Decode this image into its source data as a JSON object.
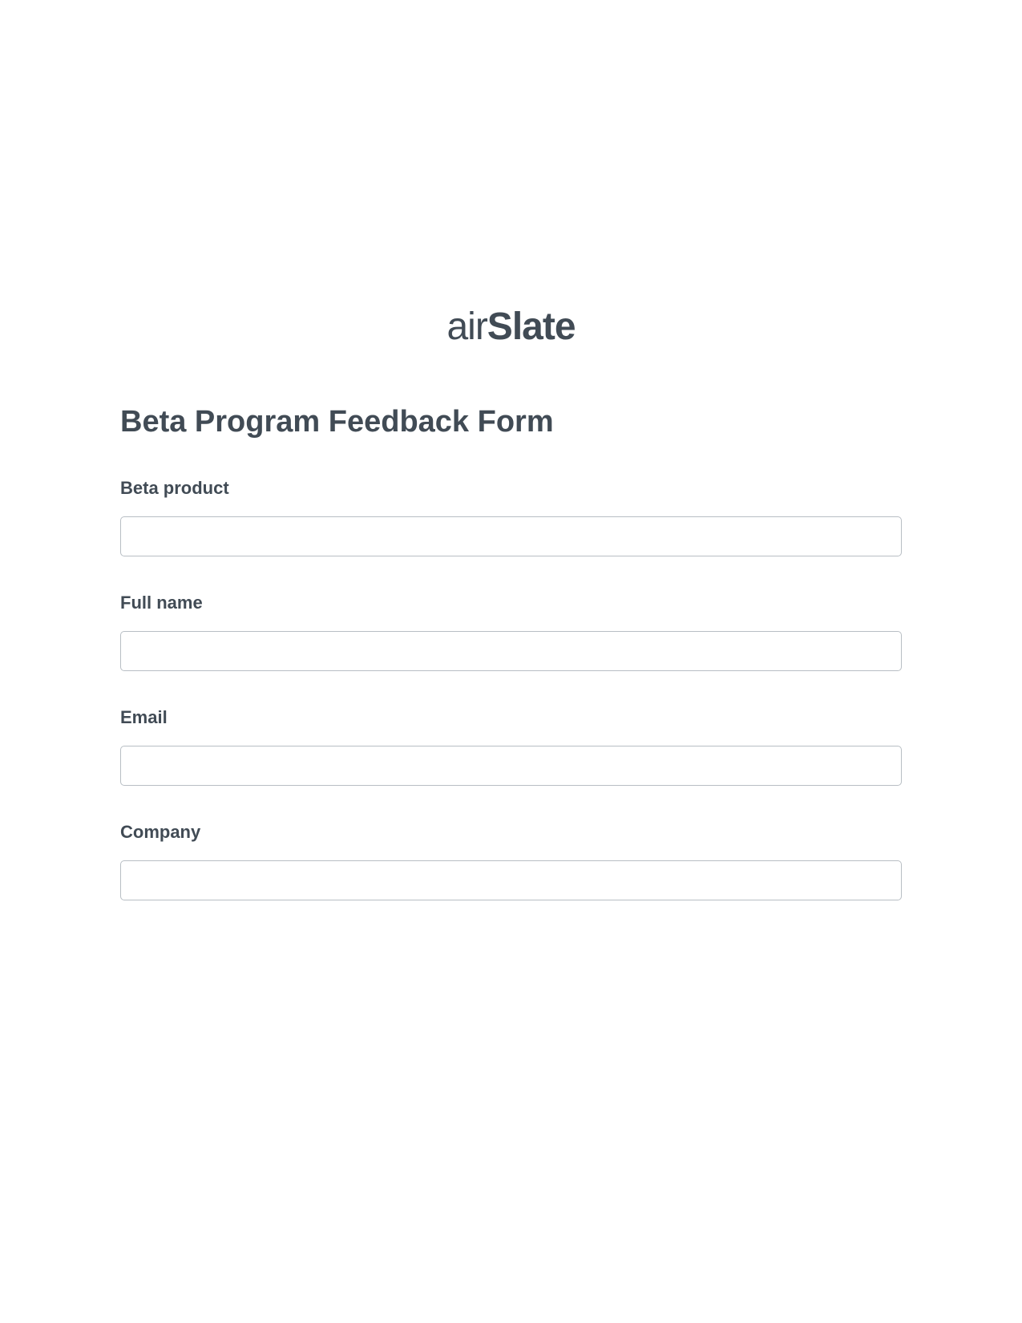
{
  "logo": {
    "part1": "air",
    "part2": "Slate"
  },
  "form": {
    "title": "Beta Program Feedback Form",
    "fields": [
      {
        "label": "Beta product",
        "value": ""
      },
      {
        "label": "Full name",
        "value": ""
      },
      {
        "label": "Email",
        "value": ""
      },
      {
        "label": "Company",
        "value": ""
      }
    ]
  }
}
